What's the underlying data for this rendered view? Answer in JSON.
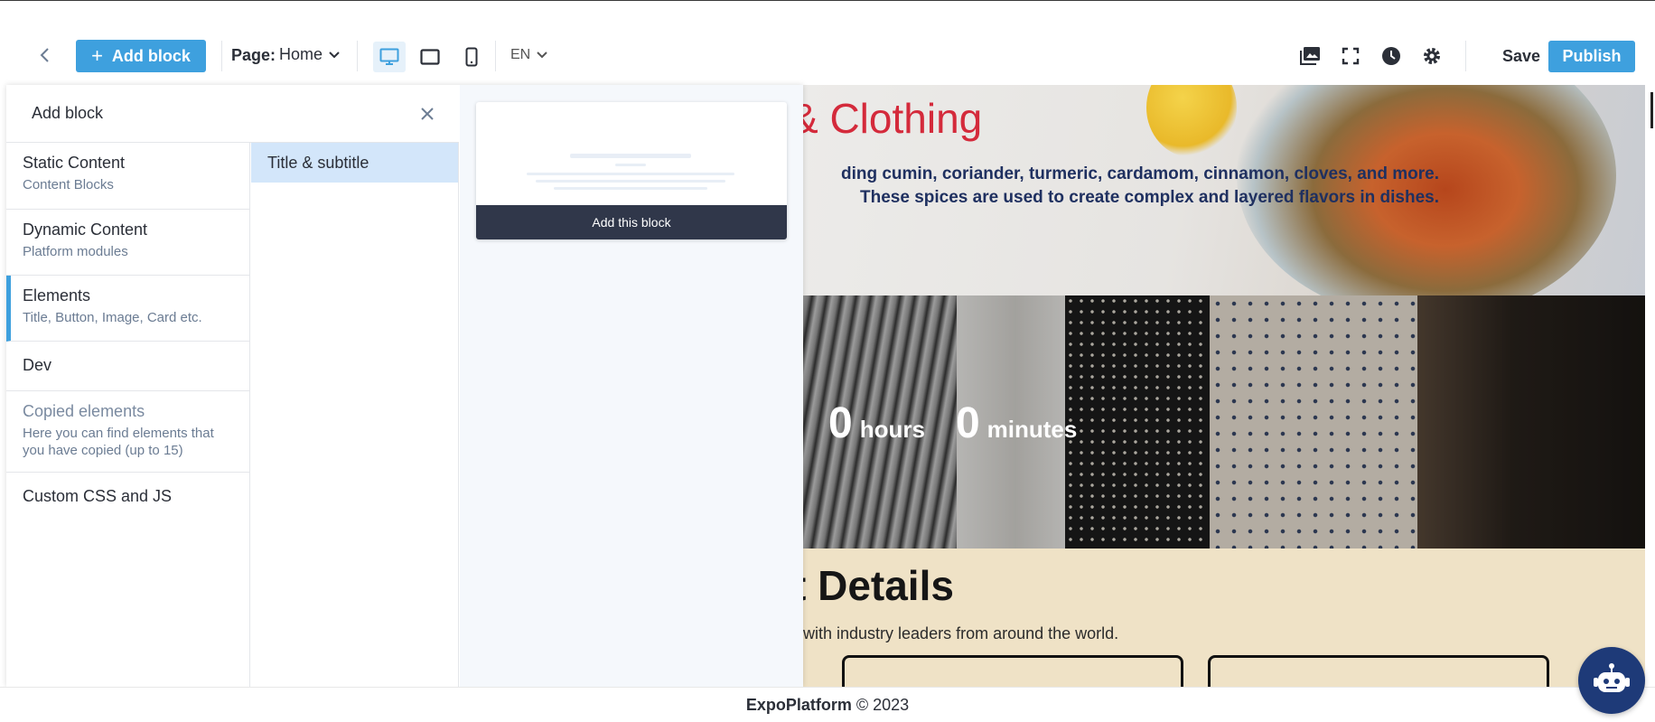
{
  "toolbar": {
    "add_block_label": "Add block",
    "page_label": "Page:",
    "page_value": "Home",
    "language": "EN",
    "save_label": "Save",
    "publish_label": "Publish",
    "icons": [
      "back-arrow-icon",
      "plus-icon",
      "chevron-down-icon",
      "desktop-icon",
      "tablet-icon",
      "mobile-icon",
      "image-gallery-icon",
      "fullscreen-icon",
      "history-clock-icon",
      "settings-gear-icon"
    ],
    "accent_color": "#3ea0de"
  },
  "panel": {
    "title": "Add block",
    "categories": [
      {
        "name": "Static Content",
        "desc": "Content Blocks"
      },
      {
        "name": "Dynamic Content",
        "desc": "Platform modules"
      },
      {
        "name": "Elements",
        "desc": "Title, Button, Image, Card etc."
      },
      {
        "name": "Dev",
        "desc": ""
      },
      {
        "name": "Copied elements",
        "desc": "Here you can find elements that you have copied (up to 15)"
      },
      {
        "name": "Custom CSS and JS",
        "desc": ""
      }
    ],
    "active_category": "Elements",
    "sub_items": [
      "Title & subtitle"
    ],
    "add_this_block_label": "Add this block"
  },
  "preview": {
    "hero_title": "& Clothing",
    "hero_text": "ding cumin, coriander, turmeric, cardamom, cinnamon, cloves, and more. These spices are used to create complex and layered flavors in dishes.",
    "countdown": [
      {
        "value": "0",
        "unit": "hours"
      },
      {
        "value": "0",
        "unit": "minutes"
      }
    ],
    "section_title": "t Details",
    "section_text": "with industry leaders from around the world.",
    "title_color": "#d42a3b",
    "section_bg": "#efe2c6"
  },
  "footer": {
    "brand": "ExpoPlatform",
    "copyright": "© 2023"
  }
}
